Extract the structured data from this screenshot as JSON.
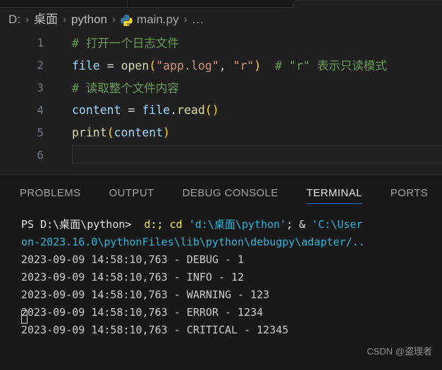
{
  "window": {
    "theme_bg": "#1f1f1f",
    "panel_bg": "#181818",
    "accent": "#0078D4"
  },
  "breadcrumb": {
    "name": "breadcrumb",
    "segments": [
      {
        "label": "D:",
        "type": "drive"
      },
      {
        "label": "桌面",
        "type": "folder"
      },
      {
        "label": "python",
        "type": "folder"
      },
      {
        "label": "main.py",
        "type": "file",
        "icon": "python-file-icon"
      }
    ],
    "separator": "›",
    "overflow": "..."
  },
  "editor": {
    "language": "python",
    "active_line": 6,
    "lines": [
      {
        "number": "1",
        "tokens": [
          {
            "text": "# 打开一个日志文件",
            "kind": "comment"
          }
        ]
      },
      {
        "number": "2",
        "tokens": [
          {
            "text": "file",
            "kind": "var"
          },
          {
            "text": " = ",
            "kind": "op"
          },
          {
            "text": "open",
            "kind": "func"
          },
          {
            "text": "(",
            "kind": "paren"
          },
          {
            "text": "\"app.log\"",
            "kind": "str"
          },
          {
            "text": ", ",
            "kind": "punct"
          },
          {
            "text": "\"r\"",
            "kind": "str"
          },
          {
            "text": ")",
            "kind": "paren"
          },
          {
            "text": "  ",
            "kind": "plain"
          },
          {
            "text": "# \"r\" 表示只读模式",
            "kind": "comment"
          }
        ]
      },
      {
        "number": "3",
        "tokens": [
          {
            "text": "# 读取整个文件内容",
            "kind": "comment"
          }
        ]
      },
      {
        "number": "4",
        "tokens": [
          {
            "text": "content",
            "kind": "var"
          },
          {
            "text": " = ",
            "kind": "op"
          },
          {
            "text": "file",
            "kind": "var"
          },
          {
            "text": ".",
            "kind": "punct"
          },
          {
            "text": "read",
            "kind": "func"
          },
          {
            "text": "()",
            "kind": "paren"
          }
        ]
      },
      {
        "number": "5",
        "tokens": [
          {
            "text": "print",
            "kind": "func"
          },
          {
            "text": "(",
            "kind": "paren"
          },
          {
            "text": "content",
            "kind": "var"
          },
          {
            "text": ")",
            "kind": "paren"
          }
        ]
      },
      {
        "number": "6",
        "tokens": []
      }
    ]
  },
  "panel": {
    "tabs": [
      {
        "label": "PROBLEMS",
        "active": false
      },
      {
        "label": "OUTPUT",
        "active": false
      },
      {
        "label": "DEBUG CONSOLE",
        "active": false
      },
      {
        "label": "TERMINAL",
        "active": true
      },
      {
        "label": "PORTS",
        "active": false
      }
    ],
    "terminal": {
      "lines": [
        {
          "segments": [
            {
              "text": "PS D:\\桌面\\python>",
              "color": "white"
            },
            {
              "text": "  ",
              "color": "white"
            },
            {
              "text": "d:;",
              "color": "yellow"
            },
            {
              "text": " ",
              "color": "white"
            },
            {
              "text": "cd",
              "color": "yellow"
            },
            {
              "text": " ",
              "color": "white"
            },
            {
              "text": "'d:\\桌面\\python'",
              "color": "cyan"
            },
            {
              "text": "; ",
              "color": "white"
            },
            {
              "text": "& ",
              "color": "white"
            },
            {
              "text": "'C:\\User",
              "color": "cyan"
            }
          ]
        },
        {
          "segments": [
            {
              "text": "on-2023.16.0\\pythonFiles\\lib\\python\\debugpy\\adapter/..",
              "color": "cyan"
            }
          ]
        },
        {
          "segments": [
            {
              "text": "2023-09-09 14:58:10,763 - DEBUG - 1",
              "color": "gray"
            }
          ]
        },
        {
          "segments": [
            {
              "text": "2023-09-09 14:58:10,763 - INFO - 12",
              "color": "gray"
            }
          ]
        },
        {
          "segments": [
            {
              "text": "2023-09-09 14:58:10,763 - WARNING - 123",
              "color": "gray"
            }
          ]
        },
        {
          "segments": [
            {
              "text": "2023-09-09 14:58:10,763 - ERROR - 1234",
              "color": "gray"
            }
          ]
        },
        {
          "segments": [
            {
              "text": "2023-09-09 14:58:10,763 - CRITICAL - 12345",
              "color": "gray"
            }
          ]
        }
      ]
    }
  },
  "watermark": {
    "text": "CSDN @盗理者"
  }
}
